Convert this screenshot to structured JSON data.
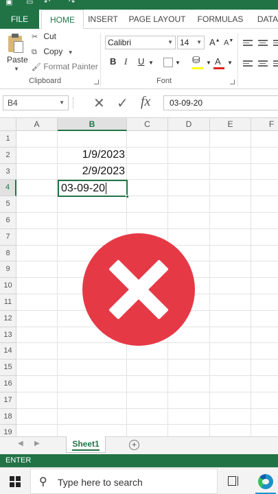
{
  "ribbon": {
    "tabs": [
      "FILE",
      "HOME",
      "INSERT",
      "PAGE LAYOUT",
      "FORMULAS",
      "DATA"
    ],
    "clipboard": {
      "paste_label": "Paste",
      "cut_label": "Cut",
      "copy_label": "Copy",
      "format_painter_label": "Format Painter",
      "group_label": "Clipboard"
    },
    "font": {
      "family": "Calibri",
      "size": "14",
      "bold": "B",
      "italic": "I",
      "underline": "U",
      "grow": "A",
      "shrink": "A",
      "color_glyph": "A",
      "group_label": "Font"
    }
  },
  "formula_bar": {
    "name_box": "B4",
    "content": "03-09-20"
  },
  "grid": {
    "columns": [
      "A",
      "B",
      "C",
      "D",
      "E",
      "F"
    ],
    "rows": [
      "1",
      "2",
      "3",
      "4",
      "5",
      "6",
      "7",
      "8",
      "9",
      "10",
      "11",
      "12",
      "13",
      "14",
      "15",
      "16",
      "17",
      "18",
      "19"
    ],
    "cells": {
      "B2": "1/9/2023",
      "B3": "2/9/2023",
      "B4": "03-09-20"
    },
    "selected_column": "B",
    "selected_row": "4"
  },
  "sheets": {
    "tabs": [
      "Sheet1"
    ],
    "add_glyph": "+"
  },
  "status": {
    "mode": "ENTER"
  },
  "taskbar": {
    "search_placeholder": "Type here to search"
  },
  "colors": {
    "excel_green": "#217346",
    "error_red": "#e63946"
  }
}
